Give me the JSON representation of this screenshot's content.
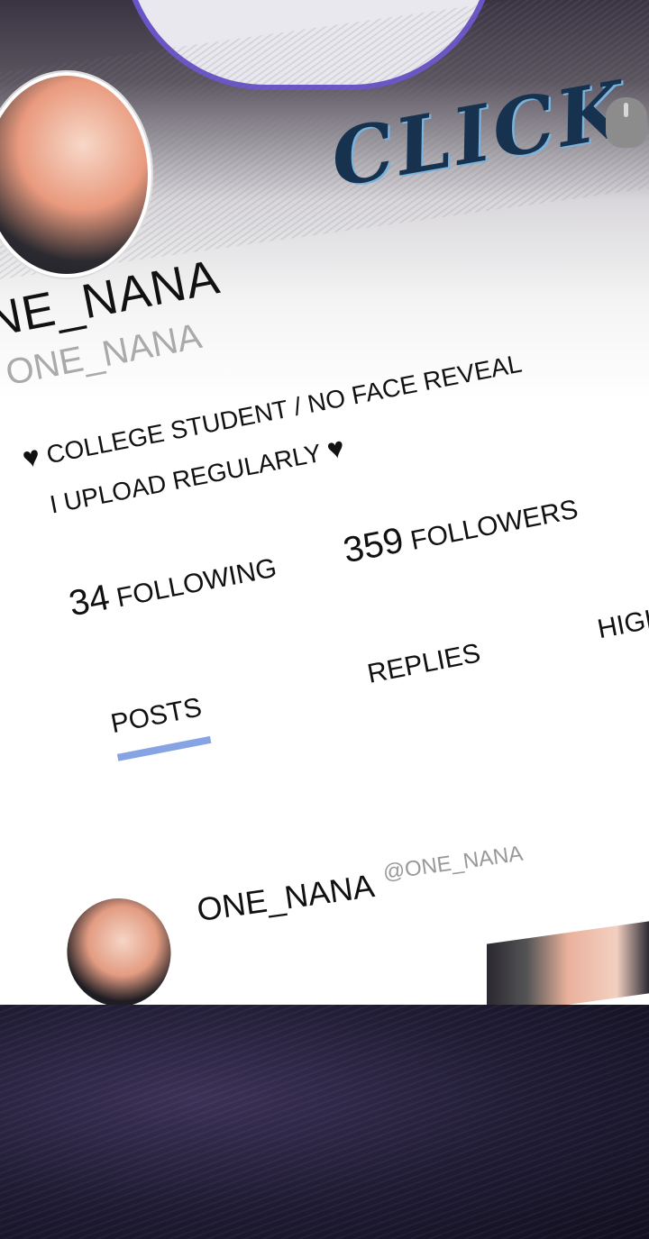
{
  "decor": {
    "click_text": "CLICK"
  },
  "profile": {
    "display_name": "NE_NANA",
    "handle": "ONE_NANA",
    "bio_line1": "COLLEGE STUDENT / NO FACE REVEAL",
    "bio_line2": "I UPLOAD REGULARLY",
    "heart": "♥"
  },
  "stats": {
    "following_count": "34",
    "following_label": "FOLLOWING",
    "followers_count": "359",
    "followers_label": "FOLLOWERS"
  },
  "tabs": [
    {
      "label": "POSTS",
      "active": true
    },
    {
      "label": "REPLIES",
      "active": false
    },
    {
      "label": "HIGHLIGHTS",
      "active": false
    }
  ],
  "post": {
    "author_name": "ONE_NANA",
    "author_handle": "@ONE_NANA"
  },
  "colors": {
    "tab_underline": "#86a4e3",
    "bubble_border": "#6a55c8",
    "click_text": "#16324f"
  }
}
